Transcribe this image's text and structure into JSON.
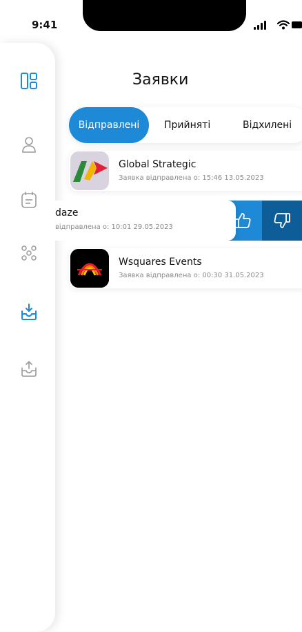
{
  "status_bar": {
    "time": "9:41"
  },
  "header": {
    "title": "Заявки"
  },
  "tabs": [
    {
      "label": "Відправлені",
      "active": true
    },
    {
      "label": "Прийняті",
      "active": false
    },
    {
      "label": "Відхилені",
      "active": false
    }
  ],
  "requests": [
    {
      "name": "Global Strategic",
      "status_text": "Заявка відправлена о: 15:46 13.05.2023",
      "logo": "global-strategic-logo"
    },
    {
      "name": "daze",
      "status_text": "відправлена о: 10:01  29.05.2023",
      "logo": ""
    },
    {
      "name": "Wsquares Events",
      "status_text": "Заявка відправлена о: 00:30 31.05.2023",
      "logo": "wsquares-events-logo"
    }
  ],
  "swipe_actions": {
    "accept_icon": "thumbs-up-icon",
    "reject_icon": "thumbs-down-icon"
  },
  "sidebar": {
    "items": [
      {
        "icon": "dashboard-icon",
        "active": true
      },
      {
        "icon": "profile-icon",
        "active": false
      },
      {
        "icon": "calendar-icon",
        "active": false
      },
      {
        "icon": "users-group-icon",
        "active": false
      },
      {
        "icon": "inbox-download-icon",
        "active": true
      },
      {
        "icon": "outbox-upload-icon",
        "active": false
      }
    ]
  },
  "colors": {
    "accent": "#1e8ad7",
    "accent_dark": "#0c5d98",
    "inactive_icon": "#9a9a9a"
  }
}
